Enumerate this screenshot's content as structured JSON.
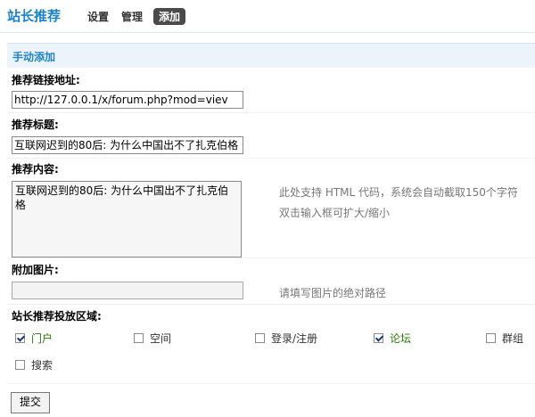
{
  "header": {
    "title": "站长推荐",
    "nav": [
      {
        "label": "设置",
        "active": false
      },
      {
        "label": "管理",
        "active": false
      },
      {
        "label": "添加",
        "active": true
      }
    ]
  },
  "section": {
    "title": "手动添加"
  },
  "form": {
    "link": {
      "label": "推荐链接地址:",
      "value": "http://127.0.0.1/x/forum.php?mod=viev"
    },
    "title": {
      "label": "推荐标题:",
      "value": "互联网迟到的80后: 为什么中国出不了扎克伯格"
    },
    "content": {
      "label": "推荐内容:",
      "value": "互联网迟到的80后: 为什么中国出不了扎克伯格",
      "hint_line1": "此处支持 HTML 代码，系统会自动截取150个字符",
      "hint_line2": "双击输入框可扩大/缩小"
    },
    "image": {
      "label": "附加图片:",
      "value": "",
      "hint": "请填写图片的绝对路径"
    },
    "areas": {
      "label": "站长推荐投放区域:",
      "options": [
        {
          "label": "门户",
          "checked": true
        },
        {
          "label": "空间",
          "checked": false
        },
        {
          "label": "登录/注册",
          "checked": false
        },
        {
          "label": "论坛",
          "checked": true
        },
        {
          "label": "群组",
          "checked": false
        },
        {
          "label": "搜索",
          "checked": false
        }
      ]
    },
    "submit_label": "提交"
  },
  "colors": {
    "accent": "#1d84c5",
    "checked_label": "#2a7a0a"
  }
}
